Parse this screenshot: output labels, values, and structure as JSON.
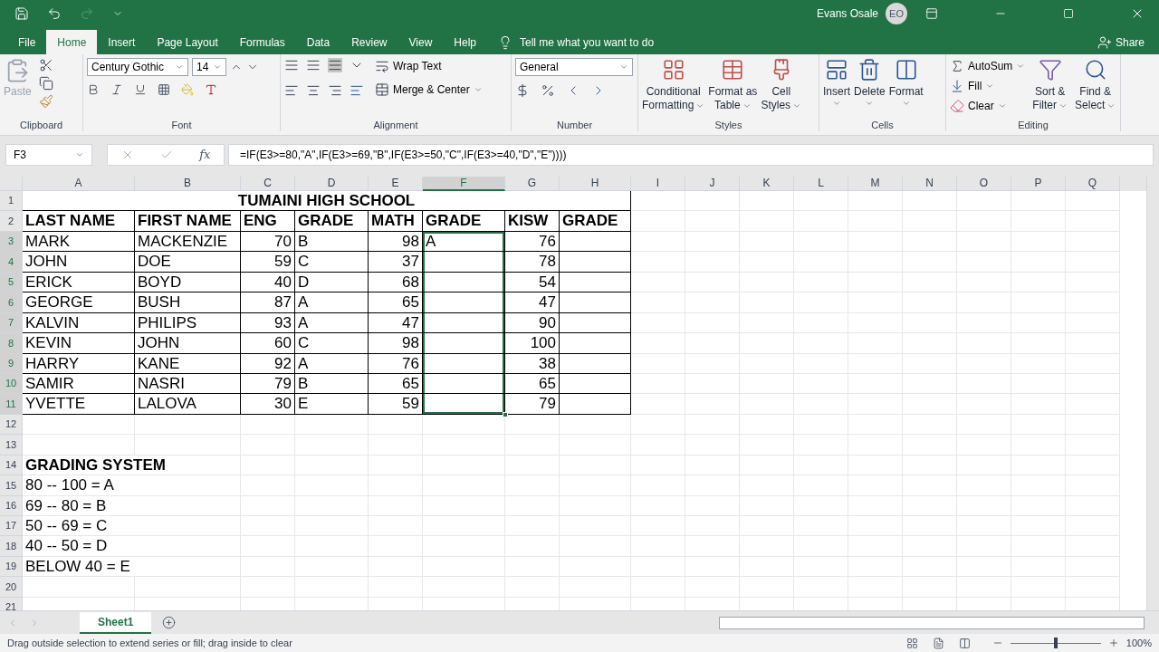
{
  "window": {
    "user": "Evans Osale",
    "avatar": "EO"
  },
  "menu_tabs": [
    {
      "label": "File",
      "selected": false
    },
    {
      "label": "Home",
      "selected": true
    },
    {
      "label": "Insert",
      "selected": false
    },
    {
      "label": "Page Layout",
      "selected": false
    },
    {
      "label": "Formulas",
      "selected": false
    },
    {
      "label": "Data",
      "selected": false
    },
    {
      "label": "Review",
      "selected": false
    },
    {
      "label": "View",
      "selected": false
    },
    {
      "label": "Help",
      "selected": false
    }
  ],
  "tell_me": "Tell me what you want to do",
  "share": "Share",
  "ribbon": {
    "paste": "Paste",
    "clipboard": "Clipboard",
    "font_name": "Century Gothic",
    "font_size": "14",
    "font": "Font",
    "wrap_text": "Wrap Text",
    "merge_center": "Merge & Center",
    "alignment": "Alignment",
    "number_format": "General",
    "number": "Number",
    "styles_buttons": [
      {
        "line1": "Conditional",
        "line2": "Formatting"
      },
      {
        "line1": "Format as",
        "line2": "Table"
      },
      {
        "line1": "Cell",
        "line2": "Styles"
      }
    ],
    "styles": "Styles",
    "cells_buttons": [
      "Insert",
      "Delete",
      "Format"
    ],
    "cells": "Cells",
    "autosum": "AutoSum",
    "fill": "Fill",
    "clear": "Clear",
    "sort_filter": {
      "line1": "Sort &",
      "line2": "Filter"
    },
    "find_select": {
      "line1": "Find &",
      "line2": "Select"
    },
    "editing": "Editing"
  },
  "formula_bar": {
    "name_box": "F3",
    "insert_function": "fx",
    "formula": "=IF(E3>=80,\"A\",IF(E3>=69,\"B\",IF(E3>=50,\"C\",IF(E3>=40,\"D\",\"E\"))))"
  },
  "columns": [
    {
      "label": "A",
      "selected": false
    },
    {
      "label": "B",
      "selected": false
    },
    {
      "label": "C",
      "selected": false
    },
    {
      "label": "D",
      "selected": false
    },
    {
      "label": "E",
      "selected": false
    },
    {
      "label": "F",
      "selected": true
    },
    {
      "label": "G",
      "selected": false
    },
    {
      "label": "H",
      "selected": false
    },
    {
      "label": "I",
      "selected": false
    },
    {
      "label": "J",
      "selected": false
    },
    {
      "label": "K",
      "selected": false
    },
    {
      "label": "L",
      "selected": false
    },
    {
      "label": "M",
      "selected": false
    },
    {
      "label": "N",
      "selected": false
    },
    {
      "label": "O",
      "selected": false
    },
    {
      "label": "P",
      "selected": false
    },
    {
      "label": "Q",
      "selected": false
    }
  ],
  "rows": [
    {
      "number": "1",
      "kind": "title",
      "selected": false,
      "cells": [
        "TUMAINI HIGH SCHOOL"
      ]
    },
    {
      "number": "2",
      "kind": "header",
      "selected": false,
      "cells": [
        "LAST NAME",
        "FIRST NAME",
        "ENG",
        "GRADE",
        "MATH",
        "GRADE",
        "KISW",
        "GRADE"
      ]
    },
    {
      "number": "3",
      "kind": "data",
      "selected": true,
      "cells": [
        "MARK",
        "MACKENZIE",
        "70",
        "B",
        "98",
        "A",
        "76",
        ""
      ]
    },
    {
      "number": "4",
      "kind": "data",
      "selected": true,
      "cells": [
        "JOHN",
        "DOE",
        "59",
        "C",
        "37",
        "",
        "78",
        ""
      ]
    },
    {
      "number": "5",
      "kind": "data",
      "selected": true,
      "cells": [
        "ERICK",
        "BOYD",
        "40",
        "D",
        "68",
        "",
        "54",
        ""
      ]
    },
    {
      "number": "6",
      "kind": "data",
      "selected": true,
      "cells": [
        "GEORGE",
        "BUSH",
        "87",
        "A",
        "65",
        "",
        "47",
        ""
      ]
    },
    {
      "number": "7",
      "kind": "data",
      "selected": true,
      "cells": [
        "KALVIN",
        "PHILIPS",
        "93",
        "A",
        "47",
        "",
        "90",
        ""
      ]
    },
    {
      "number": "8",
      "kind": "data",
      "selected": true,
      "cells": [
        "KEVIN",
        "JOHN",
        "60",
        "C",
        "98",
        "",
        "100",
        ""
      ]
    },
    {
      "number": "9",
      "kind": "data",
      "selected": true,
      "cells": [
        "HARRY",
        "KANE",
        "92",
        "A",
        "76",
        "",
        "38",
        ""
      ]
    },
    {
      "number": "10",
      "kind": "data",
      "selected": true,
      "cells": [
        "SAMIR",
        "NASRI",
        "79",
        "B",
        "65",
        "",
        "65",
        ""
      ]
    },
    {
      "number": "11",
      "kind": "data",
      "selected": true,
      "cells": [
        "YVETTE",
        "LALOVA",
        "30",
        "E",
        "59",
        "",
        "79",
        ""
      ]
    },
    {
      "number": "12",
      "kind": "empty",
      "selected": false
    },
    {
      "number": "13",
      "kind": "empty",
      "selected": false
    },
    {
      "number": "14",
      "kind": "heading",
      "selected": false,
      "cells": [
        "GRADING SYSTEM"
      ]
    },
    {
      "number": "15",
      "kind": "note",
      "selected": false,
      "cells": [
        "80 -- 100 = A"
      ]
    },
    {
      "number": "16",
      "kind": "note",
      "selected": false,
      "cells": [
        "69 -- 80 = B"
      ]
    },
    {
      "number": "17",
      "kind": "note",
      "selected": false,
      "cells": [
        "50 -- 69 = C"
      ]
    },
    {
      "number": "18",
      "kind": "note",
      "selected": false,
      "cells": [
        "40 -- 50 = D"
      ]
    },
    {
      "number": "19",
      "kind": "note",
      "selected": false,
      "cells": [
        "BELOW 40 = E"
      ]
    },
    {
      "number": "20",
      "kind": "empty",
      "selected": false
    },
    {
      "number": "21",
      "kind": "empty",
      "selected": false
    }
  ],
  "sheet_tabs": [
    {
      "label": "Sheet1",
      "selected": true
    }
  ],
  "status_bar": {
    "message": "Drag outside selection to extend series or fill; drag inside to clear",
    "zoom": "100%"
  },
  "zoom_slider": {
    "level": 0.5
  }
}
